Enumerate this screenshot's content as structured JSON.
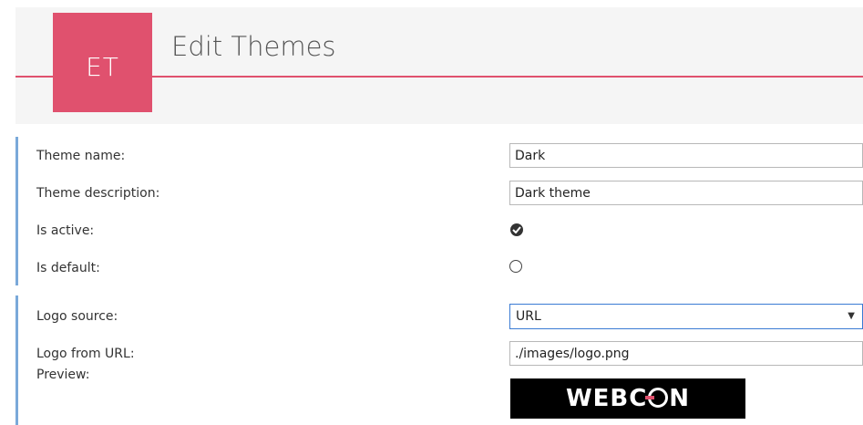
{
  "header": {
    "badge": "ET",
    "title": "Edit Themes"
  },
  "colors": {
    "accent": "#e0516e",
    "section_border": "#7aa9d9",
    "focus_border": "#3b7bd4"
  },
  "general": {
    "theme_name_label": "Theme name:",
    "theme_name_value": "Dark",
    "theme_description_label": "Theme description:",
    "theme_description_value": "Dark theme",
    "is_active_label": "Is active:",
    "is_active": true,
    "is_default_label": "Is default:",
    "is_default": false
  },
  "logo": {
    "source_label": "Logo source:",
    "source_value": "URL",
    "url_label": "Logo from URL:",
    "url_value": "./images/logo.png",
    "preview_label": "Preview:",
    "preview_text": "WEBCON"
  },
  "icons": {
    "is_active": "checked-circle-icon",
    "is_default": "empty-radio-icon",
    "dropdown": "triangle-down-icon"
  }
}
